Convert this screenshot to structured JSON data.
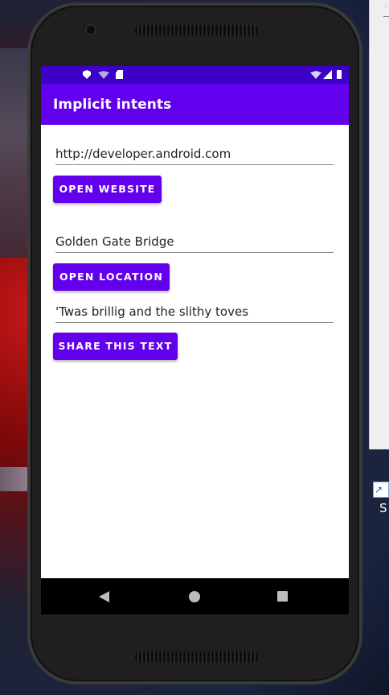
{
  "desktop": {
    "corner_text": "2",
    "shortcut_label": "S"
  },
  "status_bar": {
    "icons": [
      "shield-icon",
      "wifi-icon",
      "sd-card-icon",
      "wifi-icon",
      "signal-icon",
      "battery-icon"
    ]
  },
  "app_bar": {
    "title": "Implicit intents"
  },
  "main": {
    "website_field": {
      "value": "http://developer.android.com"
    },
    "open_website_label": "OPEN WEBSITE",
    "location_field": {
      "value": "Golden Gate Bridge"
    },
    "open_location_label": "OPEN LOCATION",
    "share_field": {
      "value": "'Twas brillig and the slithy toves"
    },
    "share_text_label": "SHARE THIS TEXT"
  },
  "nav_bar": {
    "icons": [
      "back-icon",
      "home-icon",
      "recents-icon"
    ]
  },
  "colors": {
    "primary": "#6200ee",
    "primary_dark": "#3d00c7"
  }
}
